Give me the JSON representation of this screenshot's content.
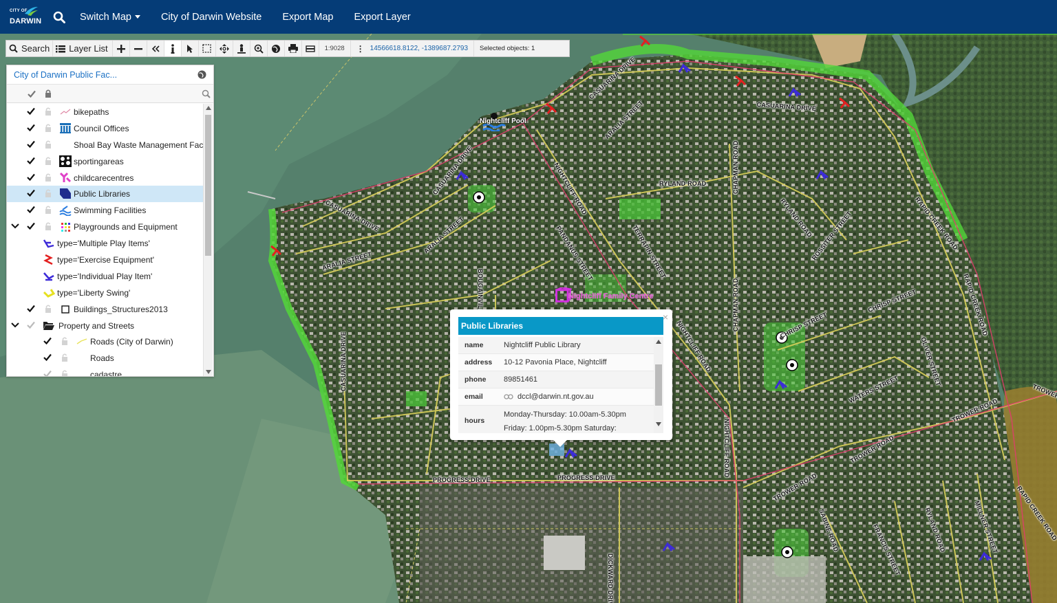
{
  "navbar": {
    "logo_small": "CITY OF",
    "logo_big": "DARWIN",
    "switch_map": "Switch Map",
    "links": [
      "City of Darwin Website",
      "Export Map",
      "Export Layer"
    ]
  },
  "toolbar": {
    "search_label": "Search",
    "layer_list_label": "Layer List",
    "scale": "1:9028",
    "coordinates": "14566618.8122, -1389687.2793",
    "selected": "Selected objects: 1"
  },
  "layer_panel": {
    "title": "City of Darwin Public Fac...",
    "rows": [
      {
        "label": "bikepaths",
        "icon": "bikepath-icon"
      },
      {
        "label": "Council Offices",
        "icon": "council-office-icon"
      },
      {
        "label": "Shoal Bay Waste Management Fac",
        "icon": "blank-icon"
      },
      {
        "label": "sportingareas",
        "icon": "soccer-ball-icon"
      },
      {
        "label": "childcarecentres",
        "icon": "childcare-icon"
      },
      {
        "label": "Public Libraries",
        "icon": "library-icon",
        "selected": true
      },
      {
        "label": "Swimming Facilities",
        "icon": "swimming-icon"
      },
      {
        "label": "Playgrounds and Equipment",
        "icon": "playground-icon"
      },
      {
        "label": "type='Multiple Play Items'",
        "icon": "multiple-play-icon"
      },
      {
        "label": "type='Exercise Equipment'",
        "icon": "exercise-equipment-icon"
      },
      {
        "label": "type='Individual Play Item'",
        "icon": "individual-play-icon"
      },
      {
        "label": "type='Liberty Swing'",
        "icon": "liberty-swing-icon"
      },
      {
        "label": "Buildings_Structures2013",
        "icon": "building-outline-icon"
      },
      {
        "label": "Property and Streets",
        "icon": "folder-icon"
      },
      {
        "label": "Roads (City of Darwin)",
        "icon": "road-line-icon"
      },
      {
        "label": "Roads",
        "icon": "blank-icon"
      },
      {
        "label": "cadastre",
        "icon": "blank-icon"
      }
    ]
  },
  "popup": {
    "title": "Public Libraries",
    "fields": [
      {
        "key": "name",
        "value": "Nightcliff Public Library"
      },
      {
        "key": "address",
        "value": "10-12 Pavonia Place, Nightcliff"
      },
      {
        "key": "phone",
        "value": "89851461"
      },
      {
        "key": "email",
        "value": "dccl@darwin.nt.gov.au"
      },
      {
        "key": "hours",
        "value_line1": "Monday-Thursday: 10.00am-5.30pm",
        "value_line2": "Friday: 1.00pm-5.30pm Saturday:"
      }
    ]
  },
  "map": {
    "streets": [
      "CASUARINA DRIVE",
      "ARALIA STREET",
      "CASUARINA DRIVE",
      "CASUARINA DRIVE",
      "ARALIA STREET",
      "ARALIA STREET",
      "CASUARINA DRIVE",
      "NIGHTCLIFF ROAD",
      "PANDANUS STREET",
      "CHAPMAN ROAD",
      "RYLAND ROAD",
      "TERRAPIN STREET",
      "RYLAND ROAD",
      "ROSSITER STREET",
      "RAPID CREEK ROAD",
      "RAPID CREEK ROAD",
      "NIGHTCLIFF ROAD",
      "CHAPMAN ROAD",
      "CHRISP STREET",
      "CHRISP STREET",
      "OLIVER STREET",
      "WATERS STREET",
      "TROWER ROAD",
      "TROWER ROAD",
      "TROWER ROAD",
      "NIGHTCLIFF ROAD",
      "PROGRESS DRIVE",
      "PROGRESS DRIVE",
      "CASUARINA DRIVE",
      "BOUGAINVILLEA STREET",
      "DICKWARD DRIVE",
      "SABINE ROAD",
      "FRANCIS STREET",
      "RYLAND ROAD",
      "MILLNER STREET",
      "RAPID CREEK ROAD",
      "TROWER"
    ],
    "poi_pool": "Nightcliff Pool",
    "poi_family": "Nightcliff Family Centre"
  }
}
